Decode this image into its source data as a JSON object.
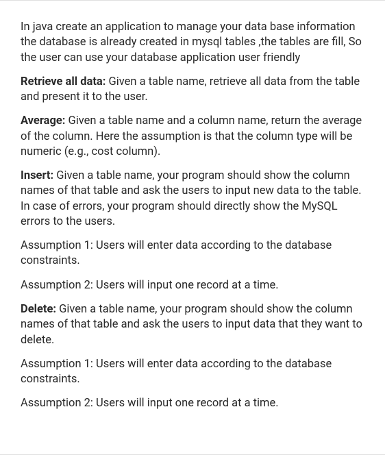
{
  "document": {
    "paragraphs": [
      {
        "lead": "",
        "text": "In java create an application to manage your data base information the database is already created in mysql tables ,the tables are fill, So the user can use your database application user friendly"
      },
      {
        "lead": "Retrieve all data: ",
        "text": "Given a table name, retrieve all data from the table and present it to the user."
      },
      {
        "lead": "Average: ",
        "text": "Given a table name and a column name, return the average of the column. Here the assumption is that the column type will be numeric (e.g., cost column)."
      },
      {
        "lead": "Insert: ",
        "text": "Given a table name, your program should show the column names of that table and ask the users to input new data to the table. In case of errors, your program should directly show the MySQL errors to the users."
      },
      {
        "lead": "",
        "text": "Assumption 1: Users will enter data according to the database constraints."
      },
      {
        "lead": "",
        "text": "Assumption 2: Users will input one record at a time."
      },
      {
        "lead": "Delete: ",
        "text": "Given a table name, your program should show the column names of that table and ask the users to input data that they want to delete."
      },
      {
        "lead": "",
        "text": "Assumption 1: Users will enter data according to the database constraints."
      },
      {
        "lead": "",
        "text": "Assumption 2: Users will input one record at a time."
      }
    ]
  }
}
